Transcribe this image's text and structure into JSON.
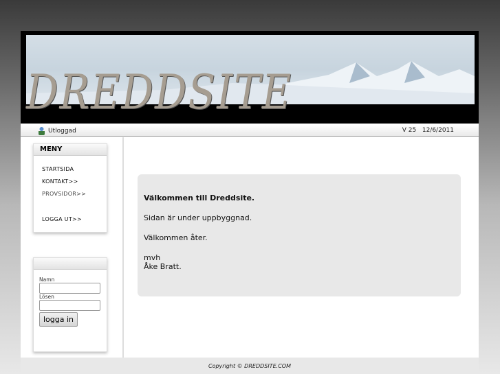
{
  "header": {
    "logo": "DREDDSITE"
  },
  "status": {
    "user": "Utloggad",
    "version": "V 25",
    "date": "12/6/2011"
  },
  "menu": {
    "title": "MENY",
    "items": [
      "STARTSIDA",
      "KONTAKT>>",
      "PROVSIDOR>>",
      "LOGGA UT>>"
    ]
  },
  "login": {
    "name_label": "Namn",
    "password_label": "Lösen",
    "button": "logga in"
  },
  "content": {
    "heading": "Välkommen till Dreddsite.",
    "line1": "Sidan är under uppbyggnad.",
    "line2": "Välkommen åter.",
    "sign1": "mvh",
    "sign2": "Åke Bratt."
  },
  "footer": {
    "copyright": "Copyright © DREDDSITE.COM"
  }
}
